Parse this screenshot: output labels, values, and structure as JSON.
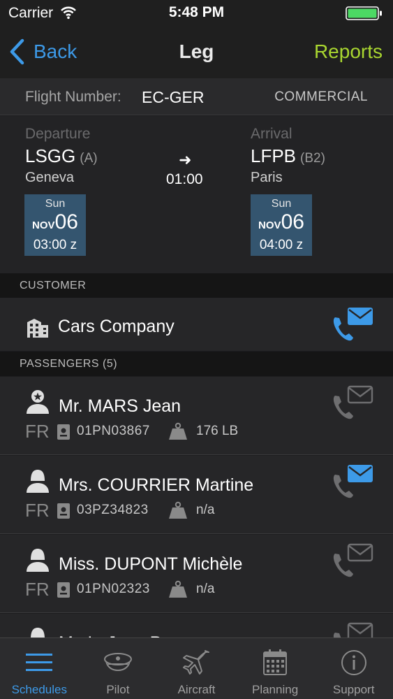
{
  "status_bar": {
    "carrier": "Carrier",
    "time": "5:48 PM"
  },
  "nav": {
    "back_label": "Back",
    "title": "Leg",
    "reports_label": "Reports"
  },
  "flight": {
    "number_label": "Flight Number:",
    "number": "EC-GER",
    "type": "COMMERCIAL"
  },
  "departure": {
    "caption": "Departure",
    "code": "LSGG",
    "class": "(A)",
    "city": "Geneva",
    "weekday": "Sun",
    "month": "NOV",
    "day": "06",
    "time": "03:00 z"
  },
  "arrival": {
    "caption": "Arrival",
    "code": "LFPB",
    "class": "(B2)",
    "city": "Paris",
    "weekday": "Sun",
    "month": "NOV",
    "day": "06",
    "time": "04:00 z"
  },
  "route": {
    "arrow": "➜",
    "duration": "01:00"
  },
  "customer": {
    "header": "CUSTOMER",
    "name": "Cars Company"
  },
  "passengers": {
    "header": "PASSENGERS (5)",
    "items": [
      {
        "name": "Mr. MARS Jean",
        "country": "FR",
        "passport": "01PN03867",
        "weight": "176 LB",
        "avatar": "captain-icon",
        "contact_active": false
      },
      {
        "name": "Mrs. COURRIER Martine",
        "country": "FR",
        "passport": "03PZ34823",
        "weight": "n/a",
        "avatar": "person-icon",
        "contact_active": true
      },
      {
        "name": "Miss. DUPONT Michèle",
        "country": "FR",
        "passport": "01PN02323",
        "weight": "n/a",
        "avatar": "person-icon",
        "contact_active": false
      },
      {
        "name": "Mr. LeJean Pa",
        "country": "",
        "passport": "",
        "weight": "",
        "avatar": "person-icon",
        "contact_active": false
      }
    ]
  },
  "tabs": [
    {
      "label": "Schedules",
      "icon": "list-icon",
      "active": true
    },
    {
      "label": "Pilot",
      "icon": "pilot-cap-icon",
      "active": false
    },
    {
      "label": "Aircraft",
      "icon": "airplane-icon",
      "active": false
    },
    {
      "label": "Planning",
      "icon": "calendar-icon",
      "active": false
    },
    {
      "label": "Support",
      "icon": "info-icon",
      "active": false
    }
  ],
  "colors": {
    "accent_blue": "#3d9ae8",
    "reports_green": "#a9d630",
    "date_tile": "#34556f",
    "battery_green": "#4cd964",
    "inactive_icon": "#7a7a7a"
  }
}
